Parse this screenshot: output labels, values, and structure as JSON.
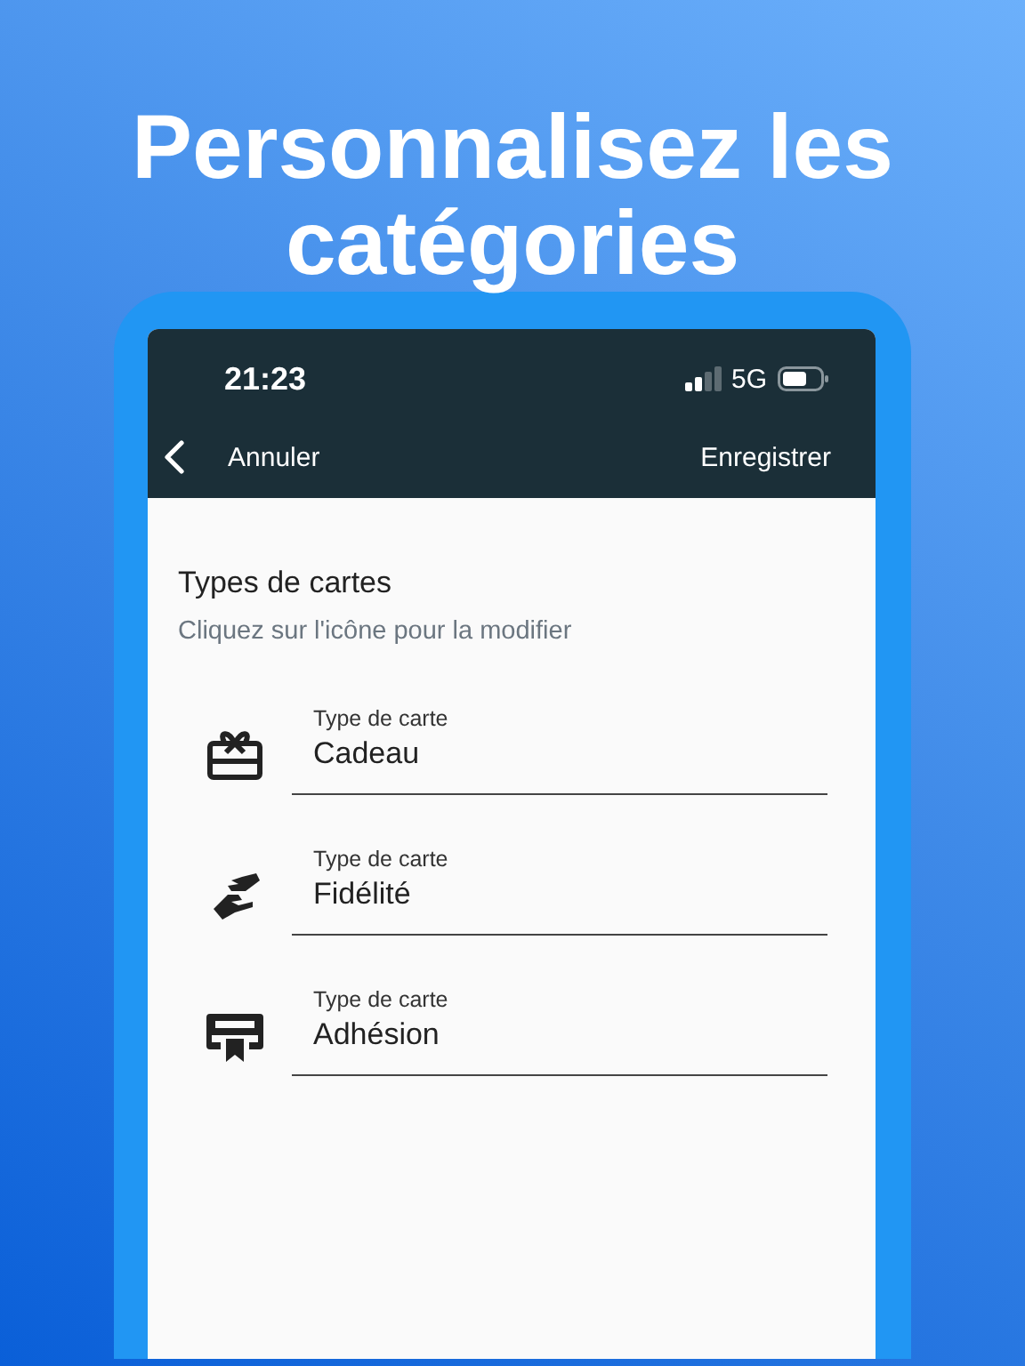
{
  "headline": "Personnalisez les catégories",
  "status_bar": {
    "time": "21:23",
    "network": "5G"
  },
  "nav": {
    "back_label": "Annuler",
    "save_label": "Enregistrer"
  },
  "section": {
    "title": "Types de cartes",
    "hint": "Cliquez sur l'icône pour la modifier"
  },
  "fields": [
    {
      "label": "Type de carte",
      "value": "Cadeau"
    },
    {
      "label": "Type de carte",
      "value": "Fidélité"
    },
    {
      "label": "Type de carte",
      "value": "Adhésion"
    }
  ]
}
